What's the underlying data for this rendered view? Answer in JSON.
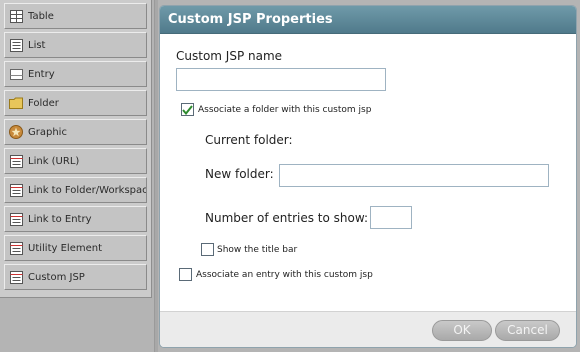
{
  "palette": {
    "items": [
      {
        "label": "Table",
        "icon": "table-icon"
      },
      {
        "label": "List",
        "icon": "list-icon"
      },
      {
        "label": "Entry",
        "icon": "entry-icon"
      },
      {
        "label": "Folder",
        "icon": "folder-icon"
      },
      {
        "label": "Graphic",
        "icon": "graphic-icon"
      },
      {
        "label": "Link (URL)",
        "icon": "link-url-icon"
      },
      {
        "label": "Link to Folder/Workspace",
        "icon": "link-folder-icon"
      },
      {
        "label": "Link to Entry",
        "icon": "link-entry-icon"
      },
      {
        "label": "Utility Element",
        "icon": "utility-icon"
      },
      {
        "label": "Custom JSP",
        "icon": "custom-jsp-icon"
      }
    ]
  },
  "dialog": {
    "title": "Custom JSP Properties",
    "name_label": "Custom JSP name",
    "name_value": "",
    "assoc_folder_label": "Associate a folder with this custom jsp",
    "assoc_folder_checked": true,
    "current_folder_label": "Current folder:",
    "new_folder_label": "New folder:",
    "new_folder_value": "",
    "num_entries_label": "Number of entries to show:",
    "num_entries_value": "",
    "show_title_label": "Show the title bar",
    "show_title_checked": false,
    "assoc_entry_label": "Associate an entry with this custom jsp",
    "assoc_entry_checked": false,
    "ok_label": "OK",
    "cancel_label": "Cancel"
  },
  "colors": {
    "title_bar": "#5f8a9b",
    "palette_bg": "#cbcbcb",
    "button_bg": "#b8b8b8",
    "checkmark": "#2e8b2e"
  }
}
